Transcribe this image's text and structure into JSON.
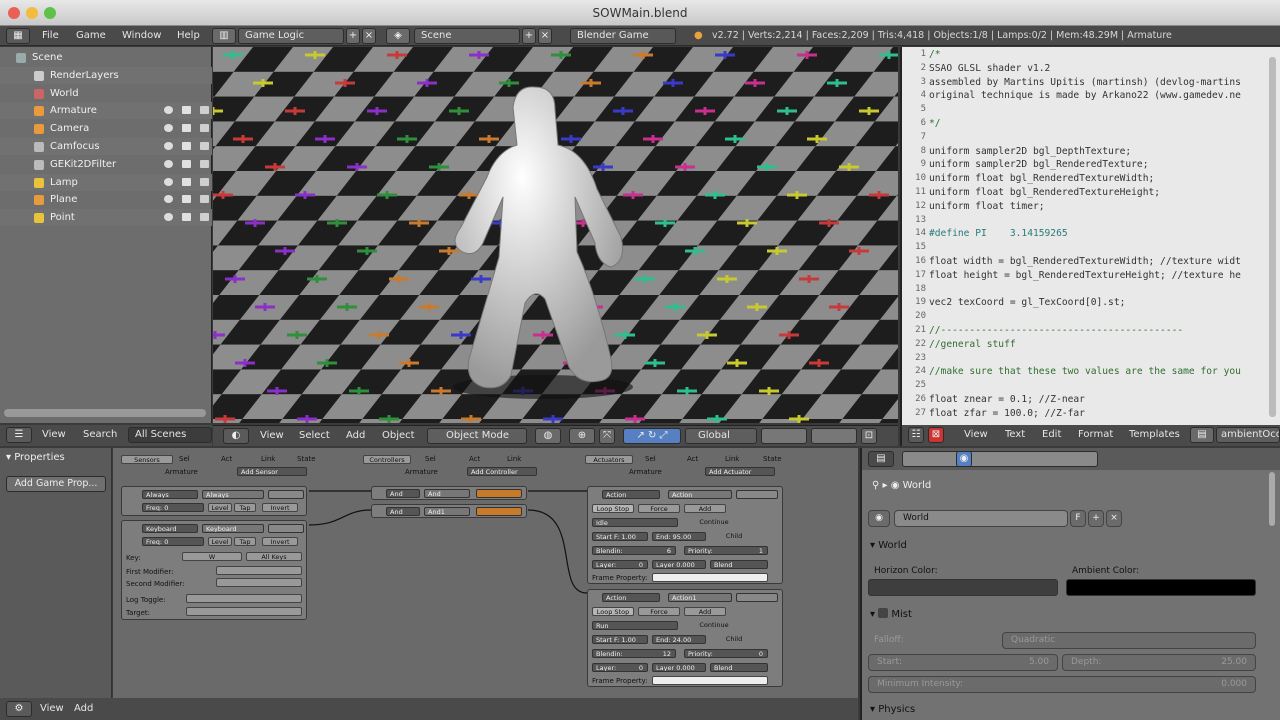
{
  "window": {
    "title": "SOWMain.blend"
  },
  "infobar": {
    "menus": [
      "File",
      "Game",
      "Window",
      "Help"
    ],
    "screen_layout": "Game Logic",
    "scene": "Scene",
    "engine": "Blender Game",
    "stats": "v2.72 | Verts:2,214 | Faces:2,209 | Tris:4,418 | Objects:1/8 | Lamps:0/2 | Mem:48.29M | Armature"
  },
  "outliner": {
    "items": [
      {
        "label": "Scene",
        "icon": "scene-icon"
      },
      {
        "label": "RenderLayers",
        "icon": "render-layers-icon"
      },
      {
        "label": "World",
        "icon": "world-icon"
      },
      {
        "label": "Armature",
        "icon": "armature-icon"
      },
      {
        "label": "Camera",
        "icon": "camera-icon"
      },
      {
        "label": "Camfocus",
        "icon": "empty-icon"
      },
      {
        "label": "GEKit2DFilter",
        "icon": "empty-icon"
      },
      {
        "label": "Lamp",
        "icon": "lamp-icon"
      },
      {
        "label": "Plane",
        "icon": "mesh-icon"
      },
      {
        "label": "Point",
        "icon": "lamp-icon"
      }
    ],
    "header": {
      "view": "View",
      "search": "Search",
      "filter": "All Scenes"
    }
  },
  "viewport_header": {
    "menus": [
      "View",
      "Select",
      "Add",
      "Object"
    ],
    "mode": "Object Mode",
    "orientation": "Global"
  },
  "text_editor": {
    "lines": [
      {
        "n": "1",
        "text": "/*"
      },
      {
        "n": "2",
        "text": "SSAO GLSL shader v1.2"
      },
      {
        "n": "3",
        "text": "assembled by Martins Upitis (martinsh) (devlog-martins"
      },
      {
        "n": "4",
        "text": "original technique is made by Arkano22 (www.gamedev.ne"
      },
      {
        "n": "5",
        "text": ""
      },
      {
        "n": "6",
        "text": "*/"
      },
      {
        "n": "7",
        "text": ""
      },
      {
        "n": "8",
        "text": "uniform sampler2D bgl_DepthTexture;"
      },
      {
        "n": "9",
        "text": "uniform sampler2D bgl_RenderedTexture;"
      },
      {
        "n": "10",
        "text": "uniform float bgl_RenderedTextureWidth;"
      },
      {
        "n": "11",
        "text": "uniform float bgl_RenderedTextureHeight;"
      },
      {
        "n": "12",
        "text": "uniform float timer;"
      },
      {
        "n": "13",
        "text": ""
      },
      {
        "n": "14",
        "text": "#define PI    3.14159265"
      },
      {
        "n": "15",
        "text": ""
      },
      {
        "n": "16",
        "text": "float width = bgl_RenderedTextureWidth; //texture widt"
      },
      {
        "n": "17",
        "text": "float height = bgl_RenderedTextureHeight; //texture he"
      },
      {
        "n": "18",
        "text": ""
      },
      {
        "n": "19",
        "text": "vec2 texCoord = gl_TexCoord[0].st;"
      },
      {
        "n": "20",
        "text": ""
      },
      {
        "n": "21",
        "text": "//------------------------------------------"
      },
      {
        "n": "22",
        "text": "//general stuff"
      },
      {
        "n": "23",
        "text": ""
      },
      {
        "n": "24",
        "text": "//make sure that these two values are the same for you"
      },
      {
        "n": "25",
        "text": ""
      },
      {
        "n": "26",
        "text": "float znear = 0.1; //Z-near"
      },
      {
        "n": "27",
        "text": "float zfar = 100.0; //Z-far"
      }
    ],
    "header": {
      "menus": [
        "View",
        "Text",
        "Edit",
        "Format",
        "Templates"
      ],
      "datablock": "ambientOcc"
    }
  },
  "properties": {
    "title": "Properties",
    "add_button": "Add Game Prop..."
  },
  "logic": {
    "sensors": {
      "column_label": "Sensors",
      "filters": [
        "Sel",
        "Act",
        "Link",
        "State"
      ],
      "object": "Armature",
      "add": "Add Sensor",
      "s1_type": "Always",
      "s1_name": "Always",
      "freq_label": "Freq:",
      "freq_value": "0",
      "level": "Level",
      "tap": "Tap",
      "invert": "Invert",
      "s2_type": "Keyboard",
      "s2_name": "Keyboard",
      "key_label": "Key:",
      "key_value": "W",
      "all_keys": "All Keys",
      "first_mod": "First Modifier:",
      "second_mod": "Second Modifier:",
      "log_toggle": "Log Toggle:",
      "target": "Target:"
    },
    "controllers": {
      "column_label": "Controllers",
      "filters": [
        "Sel",
        "Act",
        "Link"
      ],
      "object": "Armature",
      "add": "Add Controller",
      "c1_type": "And",
      "c1_name": "And",
      "c2_type": "And",
      "c2_name": "And1"
    },
    "actuators": {
      "column_label": "Actuators",
      "filters": [
        "Sel",
        "Act",
        "Link",
        "State"
      ],
      "object": "Armature",
      "add": "Add Actuator",
      "a1_type": "Action",
      "a1_name": "Action",
      "a1_mode": "Loop Stop",
      "a1_force": "Force",
      "a1_add": "Add",
      "a1_action": "Idle",
      "continue": "Continue",
      "a1_start": "Start F: 1.00",
      "a1_end": "End: 95.00",
      "child": "Child",
      "a1_blendin": "Blendin:",
      "a1_blendin_val": "6",
      "a1_priority": "Priority:",
      "a1_priority_val": "1",
      "a1_layer": "Layer:",
      "a1_layer_val": "0",
      "a1_weight": "Layer 0.000",
      "blend": "Blend",
      "frame_prop": "Frame Property:",
      "a2_type": "Action",
      "a2_name": "Action1",
      "a2_mode": "Loop Stop",
      "a2_force": "Force",
      "a2_add": "Add",
      "a2_action": "Run",
      "a2_start": "Start F: 1.00",
      "a2_end": "End: 24.00",
      "a2_blendin": "Blendin:",
      "a2_blendin_val": "12",
      "a2_priority": "Priority:",
      "a2_priority_val": "0",
      "a2_layer": "Layer:",
      "a2_layer_val": "0",
      "a2_weight": "Layer 0.000"
    },
    "header": {
      "menus": [
        "View",
        "Add"
      ]
    }
  },
  "world_panel": {
    "context": "World",
    "datablock": "World",
    "fake_user": "F",
    "section_world": "World",
    "horizon_label": "Horizon Color:",
    "ambient_label": "Ambient Color:",
    "horizon_color": "#3e3e3e",
    "ambient_color": "#000000",
    "section_mist": "Mist",
    "falloff_label": "Falloff:",
    "falloff_value": "Quadratic",
    "start_label": "Start:",
    "start_value": "5.00",
    "depth_label": "Depth:",
    "depth_value": "25.00",
    "min_intensity_label": "Minimum Intensity:",
    "min_intensity_value": "0.000",
    "section_physics": "Physics"
  }
}
